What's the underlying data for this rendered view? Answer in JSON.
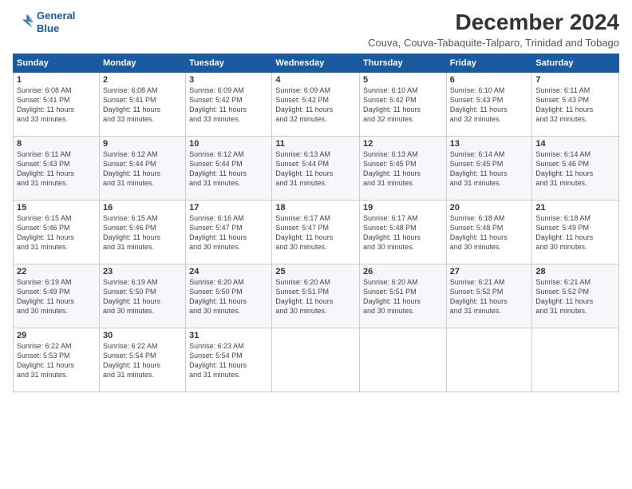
{
  "logo": {
    "line1": "General",
    "line2": "Blue"
  },
  "title": "December 2024",
  "location": "Couva, Couva-Tabaquite-Talparo, Trinidad and Tobago",
  "headers": [
    "Sunday",
    "Monday",
    "Tuesday",
    "Wednesday",
    "Thursday",
    "Friday",
    "Saturday"
  ],
  "weeks": [
    [
      {
        "day": "1",
        "info": "Sunrise: 6:08 AM\nSunset: 5:41 PM\nDaylight: 11 hours\nand 33 minutes."
      },
      {
        "day": "2",
        "info": "Sunrise: 6:08 AM\nSunset: 5:41 PM\nDaylight: 11 hours\nand 33 minutes."
      },
      {
        "day": "3",
        "info": "Sunrise: 6:09 AM\nSunset: 5:42 PM\nDaylight: 11 hours\nand 33 minutes."
      },
      {
        "day": "4",
        "info": "Sunrise: 6:09 AM\nSunset: 5:42 PM\nDaylight: 11 hours\nand 32 minutes."
      },
      {
        "day": "5",
        "info": "Sunrise: 6:10 AM\nSunset: 5:42 PM\nDaylight: 11 hours\nand 32 minutes."
      },
      {
        "day": "6",
        "info": "Sunrise: 6:10 AM\nSunset: 5:43 PM\nDaylight: 11 hours\nand 32 minutes."
      },
      {
        "day": "7",
        "info": "Sunrise: 6:11 AM\nSunset: 5:43 PM\nDaylight: 11 hours\nand 32 minutes."
      }
    ],
    [
      {
        "day": "8",
        "info": "Sunrise: 6:11 AM\nSunset: 5:43 PM\nDaylight: 11 hours\nand 31 minutes."
      },
      {
        "day": "9",
        "info": "Sunrise: 6:12 AM\nSunset: 5:44 PM\nDaylight: 11 hours\nand 31 minutes."
      },
      {
        "day": "10",
        "info": "Sunrise: 6:12 AM\nSunset: 5:44 PM\nDaylight: 11 hours\nand 31 minutes."
      },
      {
        "day": "11",
        "info": "Sunrise: 6:13 AM\nSunset: 5:44 PM\nDaylight: 11 hours\nand 31 minutes."
      },
      {
        "day": "12",
        "info": "Sunrise: 6:13 AM\nSunset: 5:45 PM\nDaylight: 11 hours\nand 31 minutes."
      },
      {
        "day": "13",
        "info": "Sunrise: 6:14 AM\nSunset: 5:45 PM\nDaylight: 11 hours\nand 31 minutes."
      },
      {
        "day": "14",
        "info": "Sunrise: 6:14 AM\nSunset: 5:46 PM\nDaylight: 11 hours\nand 31 minutes."
      }
    ],
    [
      {
        "day": "15",
        "info": "Sunrise: 6:15 AM\nSunset: 5:46 PM\nDaylight: 11 hours\nand 31 minutes."
      },
      {
        "day": "16",
        "info": "Sunrise: 6:15 AM\nSunset: 5:46 PM\nDaylight: 11 hours\nand 31 minutes."
      },
      {
        "day": "17",
        "info": "Sunrise: 6:16 AM\nSunset: 5:47 PM\nDaylight: 11 hours\nand 30 minutes."
      },
      {
        "day": "18",
        "info": "Sunrise: 6:17 AM\nSunset: 5:47 PM\nDaylight: 11 hours\nand 30 minutes."
      },
      {
        "day": "19",
        "info": "Sunrise: 6:17 AM\nSunset: 5:48 PM\nDaylight: 11 hours\nand 30 minutes."
      },
      {
        "day": "20",
        "info": "Sunrise: 6:18 AM\nSunset: 5:48 PM\nDaylight: 11 hours\nand 30 minutes."
      },
      {
        "day": "21",
        "info": "Sunrise: 6:18 AM\nSunset: 5:49 PM\nDaylight: 11 hours\nand 30 minutes."
      }
    ],
    [
      {
        "day": "22",
        "info": "Sunrise: 6:19 AM\nSunset: 5:49 PM\nDaylight: 11 hours\nand 30 minutes."
      },
      {
        "day": "23",
        "info": "Sunrise: 6:19 AM\nSunset: 5:50 PM\nDaylight: 11 hours\nand 30 minutes."
      },
      {
        "day": "24",
        "info": "Sunrise: 6:20 AM\nSunset: 5:50 PM\nDaylight: 11 hours\nand 30 minutes."
      },
      {
        "day": "25",
        "info": "Sunrise: 6:20 AM\nSunset: 5:51 PM\nDaylight: 11 hours\nand 30 minutes."
      },
      {
        "day": "26",
        "info": "Sunrise: 6:20 AM\nSunset: 5:51 PM\nDaylight: 11 hours\nand 30 minutes."
      },
      {
        "day": "27",
        "info": "Sunrise: 6:21 AM\nSunset: 5:52 PM\nDaylight: 11 hours\nand 31 minutes."
      },
      {
        "day": "28",
        "info": "Sunrise: 6:21 AM\nSunset: 5:52 PM\nDaylight: 11 hours\nand 31 minutes."
      }
    ],
    [
      {
        "day": "29",
        "info": "Sunrise: 6:22 AM\nSunset: 5:53 PM\nDaylight: 11 hours\nand 31 minutes."
      },
      {
        "day": "30",
        "info": "Sunrise: 6:22 AM\nSunset: 5:54 PM\nDaylight: 11 hours\nand 31 minutes."
      },
      {
        "day": "31",
        "info": "Sunrise: 6:23 AM\nSunset: 5:54 PM\nDaylight: 11 hours\nand 31 minutes."
      },
      {
        "day": "",
        "info": ""
      },
      {
        "day": "",
        "info": ""
      },
      {
        "day": "",
        "info": ""
      },
      {
        "day": "",
        "info": ""
      }
    ]
  ]
}
